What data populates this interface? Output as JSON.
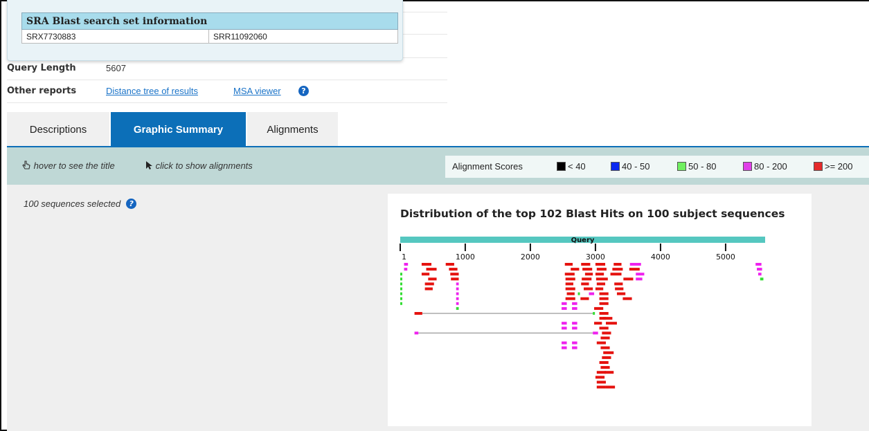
{
  "sra_popup": {
    "header": "SRA Blast search set information",
    "experiment": "SRX7730883",
    "run": "SRR11092060"
  },
  "info": {
    "query_length_label": "Query Length",
    "query_length_value": "5607",
    "other_reports_label": "Other reports",
    "link_distance_tree": "Distance tree of results",
    "link_msa_viewer": "MSA viewer",
    "help_icon": "question-circle"
  },
  "tabs": [
    {
      "label": "Descriptions",
      "active": false
    },
    {
      "label": "Graphic Summary",
      "active": true
    },
    {
      "label": "Alignments",
      "active": false
    }
  ],
  "toolbar": {
    "hover_hint": "hover to see the title",
    "click_hint": "click to show alignments",
    "legend_title": "Alignment Scores",
    "legend": [
      {
        "label": "< 40",
        "color": "#000000"
      },
      {
        "label": "40 - 50",
        "color": "#0a28f0"
      },
      {
        "label": "50 - 80",
        "color": "#70f060"
      },
      {
        "label": "80 - 200",
        "color": "#e040e8"
      },
      {
        "label": ">= 200",
        "color": "#e52b2b"
      }
    ]
  },
  "content": {
    "selected_text": "100 sequences selected"
  },
  "graphic": {
    "title": "Distribution of the top 102 Blast Hits on 100 subject sequences",
    "query_label": "Query",
    "query_length": 5607,
    "ticks": [
      "1",
      "1000",
      "2000",
      "3000",
      "4000",
      "5000"
    ],
    "colors": {
      "query_bar": "#55c7c0",
      "red": "#e5130f",
      "magenta": "#ee22ee",
      "green": "#33dd33",
      "connector": "#999999"
    }
  },
  "chart_data": {
    "type": "alignment_map",
    "query_length": 5607,
    "axis_ticks": [
      1,
      1000,
      2000,
      3000,
      4000,
      5000
    ],
    "hits": [
      {
        "row": 0,
        "segments": [
          {
            "start": 60,
            "end": 120,
            "c": "m"
          },
          {
            "start": 330,
            "end": 480,
            "c": "r"
          },
          {
            "start": 700,
            "end": 830,
            "c": "r"
          },
          {
            "start": 2530,
            "end": 2650,
            "c": "r"
          },
          {
            "start": 2780,
            "end": 2920,
            "c": "r"
          },
          {
            "start": 3000,
            "end": 3150,
            "c": "r"
          },
          {
            "start": 3280,
            "end": 3400,
            "c": "r"
          },
          {
            "start": 3530,
            "end": 3700,
            "c": "m"
          },
          {
            "start": 5460,
            "end": 5550,
            "c": "m"
          }
        ]
      },
      {
        "row": 1,
        "segments": [
          {
            "start": 60,
            "end": 110,
            "c": "m"
          },
          {
            "start": 400,
            "end": 560,
            "c": "r"
          },
          {
            "start": 750,
            "end": 880,
            "c": "r"
          },
          {
            "start": 2620,
            "end": 2750,
            "c": "r"
          },
          {
            "start": 2800,
            "end": 2950,
            "c": "r"
          },
          {
            "start": 3020,
            "end": 3170,
            "c": "r"
          },
          {
            "start": 3260,
            "end": 3420,
            "c": "r"
          },
          {
            "start": 3520,
            "end": 3680,
            "c": "r"
          },
          {
            "start": 5480,
            "end": 5560,
            "c": "m"
          }
        ]
      },
      {
        "row": 2,
        "segments": [
          {
            "start": 1,
            "end": 10,
            "c": "g"
          },
          {
            "start": 330,
            "end": 450,
            "c": "r"
          },
          {
            "start": 770,
            "end": 900,
            "c": "r"
          },
          {
            "start": 2530,
            "end": 2680,
            "c": "r"
          },
          {
            "start": 2840,
            "end": 2960,
            "c": "r"
          },
          {
            "start": 3000,
            "end": 3130,
            "c": "r"
          },
          {
            "start": 3230,
            "end": 3400,
            "c": "r"
          },
          {
            "start": 3620,
            "end": 3750,
            "c": "m"
          },
          {
            "start": 5500,
            "end": 5550,
            "c": "m"
          }
        ]
      },
      {
        "row": 3,
        "segments": [
          {
            "start": 1,
            "end": 10,
            "c": "g"
          },
          {
            "start": 430,
            "end": 560,
            "c": "r"
          },
          {
            "start": 780,
            "end": 900,
            "c": "r"
          },
          {
            "start": 2540,
            "end": 2690,
            "c": "r"
          },
          {
            "start": 2790,
            "end": 2940,
            "c": "r"
          },
          {
            "start": 3010,
            "end": 3190,
            "c": "r"
          },
          {
            "start": 3430,
            "end": 3580,
            "c": "r"
          },
          {
            "start": 3620,
            "end": 3720,
            "c": "m"
          },
          {
            "start": 5530,
            "end": 5580,
            "c": "g"
          }
        ]
      }
    ]
  }
}
